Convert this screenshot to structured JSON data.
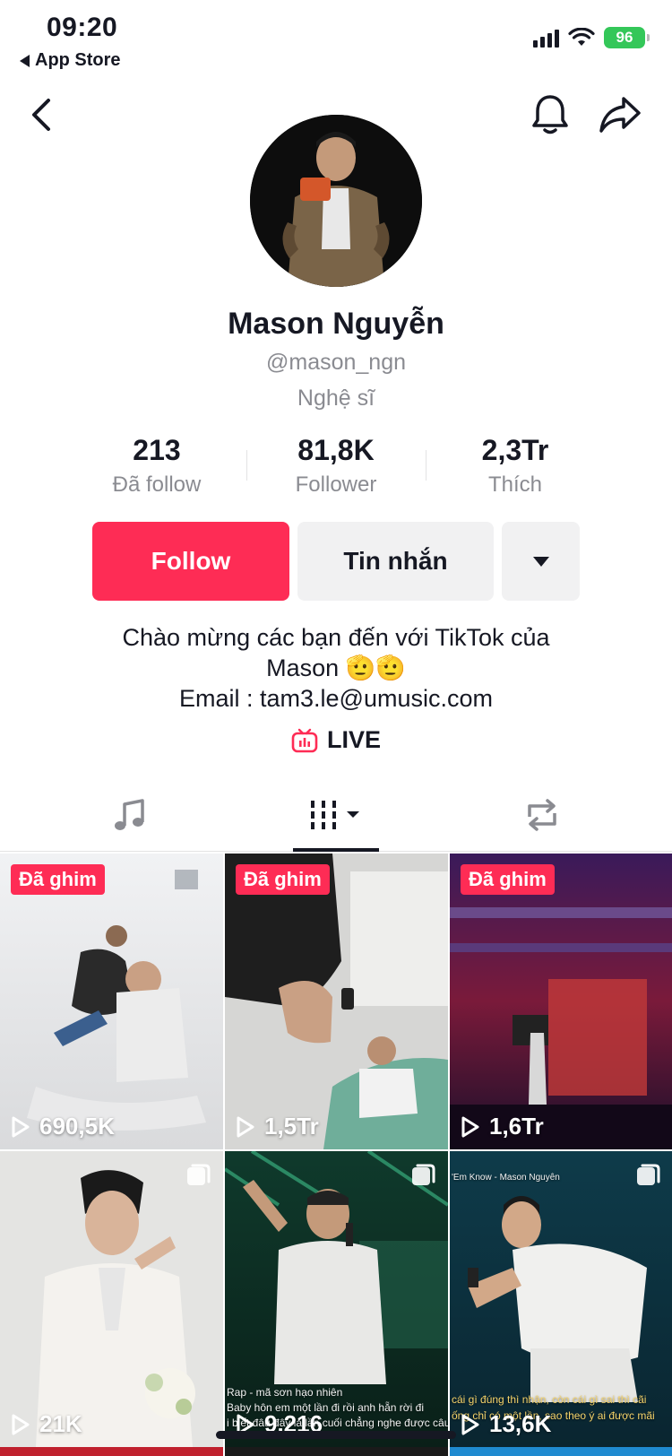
{
  "status_bar": {
    "time": "09:20",
    "back_app_label": "App Store",
    "battery": "96"
  },
  "nav": {
    "back_icon": "chevron-left-icon",
    "bell_icon": "bell-icon",
    "share_icon": "share-arrow-icon"
  },
  "profile": {
    "name": "Mason Nguyễn",
    "handle": "@mason_ngn",
    "category": "Nghệ sĩ"
  },
  "stats": [
    {
      "value": "213",
      "label": "Đã follow"
    },
    {
      "value": "81,8K",
      "label": "Follower"
    },
    {
      "value": "2,3Tr",
      "label": "Thích"
    }
  ],
  "actions": {
    "follow_label": "Follow",
    "message_label": "Tin nhắn"
  },
  "bio": {
    "line1": "Chào mừng các bạn đến với TikTok của",
    "line2": "Mason 🫡🫡",
    "line3": "Email : tam3.le@umusic.com"
  },
  "live": {
    "label": "LIVE"
  },
  "tabs": [
    {
      "icon": "music-note-icon"
    },
    {
      "icon": "video-grid-icon"
    },
    {
      "icon": "repost-icon"
    }
  ],
  "videos": [
    {
      "pinned": true,
      "pin_label": "Đã ghim",
      "views": "690,5K"
    },
    {
      "pinned": true,
      "pin_label": "Đã ghim",
      "views": "1,5Tr"
    },
    {
      "pinned": true,
      "pin_label": "Đã ghim",
      "views": "1,6Tr"
    },
    {
      "pinned": false,
      "views": "21K"
    },
    {
      "pinned": false,
      "views": "9.216",
      "caption1": "Rap - mã  sơn hạo nhiên",
      "caption2": "Baby hôn em một lần đi rồi anh hẵn rời đi",
      "caption3": "i biết đâu đây là lần cuối chẳng nghe được câu"
    },
    {
      "pinned": false,
      "views": "13,6K",
      "caption_top": "'Em Know - Mason Nguyên",
      "caption1": "cái gì đúng thì nhận, còn cái gì sai thì cãi",
      "caption2": "ống chỉ có một lần, sao theo ý ai được mãi"
    }
  ],
  "colors": {
    "accent": "#fe2c55",
    "text": "#161823",
    "muted": "#8a8b91",
    "button_bg": "#f1f1f2"
  }
}
